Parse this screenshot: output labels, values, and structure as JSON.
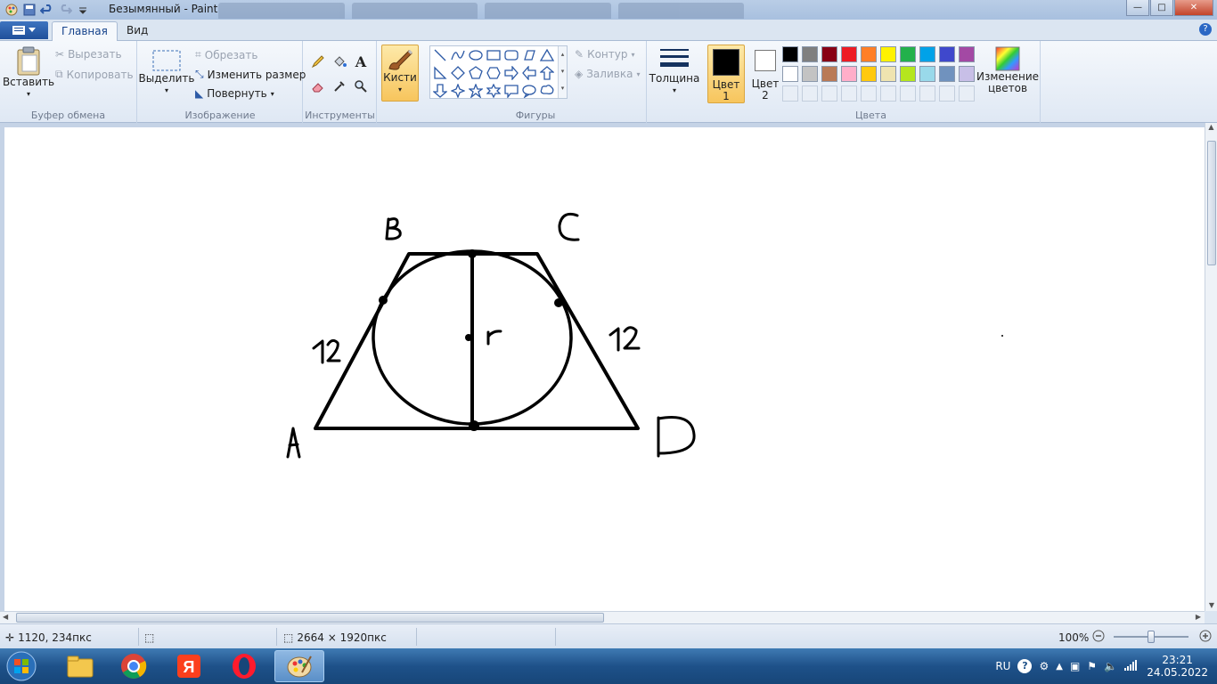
{
  "window": {
    "title": "Безымянный - Paint",
    "controls": {
      "minimize": "—",
      "maximize": "□",
      "close": "✕"
    }
  },
  "ribbon_tabs": {
    "home": "Главная",
    "view": "Вид"
  },
  "clipboard": {
    "paste": "Вставить",
    "cut": "Вырезать",
    "copy": "Копировать",
    "label": "Буфер обмена"
  },
  "image": {
    "select": "Выделить",
    "crop": "Обрезать",
    "resize": "Изменить размер",
    "rotate": "Повернуть",
    "label": "Изображение"
  },
  "tools": {
    "label": "Инструменты"
  },
  "brushes": {
    "label": "Кисти"
  },
  "shapes": {
    "outline": "Контур",
    "fill": "Заливка",
    "label": "Фигуры"
  },
  "size": {
    "label": "Толщина"
  },
  "colors": {
    "color1_line1": "Цвет",
    "color1_line2": "1",
    "color2_line1": "Цвет",
    "color2_line2": "2",
    "edit_line1": "Изменение",
    "edit_line2": "цветов",
    "label": "Цвета",
    "color1": "#000000",
    "color2": "#ffffff",
    "palette_row1": [
      "#000000",
      "#7f7f7f",
      "#880015",
      "#ed1c24",
      "#ff7f27",
      "#fff200",
      "#22b14c",
      "#00a2e8",
      "#3f48cc",
      "#a349a4"
    ],
    "palette_row2": [
      "#ffffff",
      "#c3c3c3",
      "#b97a57",
      "#ffaec9",
      "#ffc90e",
      "#efe4b0",
      "#b5e61d",
      "#99d9ea",
      "#7092be",
      "#c8bfe7"
    ]
  },
  "drawing": {
    "label_b": "B",
    "label_c": "C",
    "label_a": "A",
    "label_d": "D",
    "side_left": "12",
    "side_right": "12",
    "radius": "r"
  },
  "status": {
    "cursor_pos": "1120, 234пкс",
    "image_size": "2664 × 1920пкс",
    "zoom": "100%"
  },
  "taskbar": {
    "lang": "RU",
    "time": "23:21",
    "date": "24.05.2022"
  }
}
